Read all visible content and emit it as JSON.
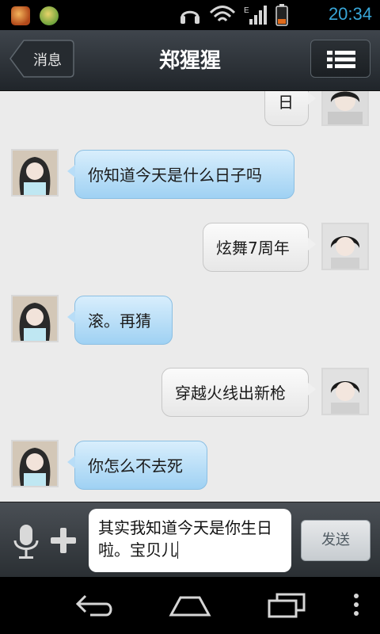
{
  "status_bar": {
    "time": "20:34",
    "icons": [
      "app-icon-1",
      "app-icon-2",
      "headset-icon",
      "wifi-icon",
      "edge-signal-icon",
      "battery-icon"
    ],
    "network_label": "E"
  },
  "header": {
    "back_label": "消息",
    "title": "郑猩猩"
  },
  "messages": [
    {
      "side": "out",
      "text": "日"
    },
    {
      "side": "in",
      "text": "你知道今天是什么日子吗"
    },
    {
      "side": "out",
      "text": "炫舞7周年"
    },
    {
      "side": "in",
      "text": "滚。再猜"
    },
    {
      "side": "out",
      "text": "穿越火线出新枪"
    },
    {
      "side": "in",
      "text": "你怎么不去死"
    }
  ],
  "composer": {
    "input_value": "其实我知道今天是你生日啦。宝贝儿",
    "send_label": "发送"
  },
  "colors": {
    "time": "#38a6d8",
    "incoming_bubble": "#b8ddf7",
    "outgoing_bubble": "#f0f0f0",
    "chat_bg": "#ebebeb"
  }
}
